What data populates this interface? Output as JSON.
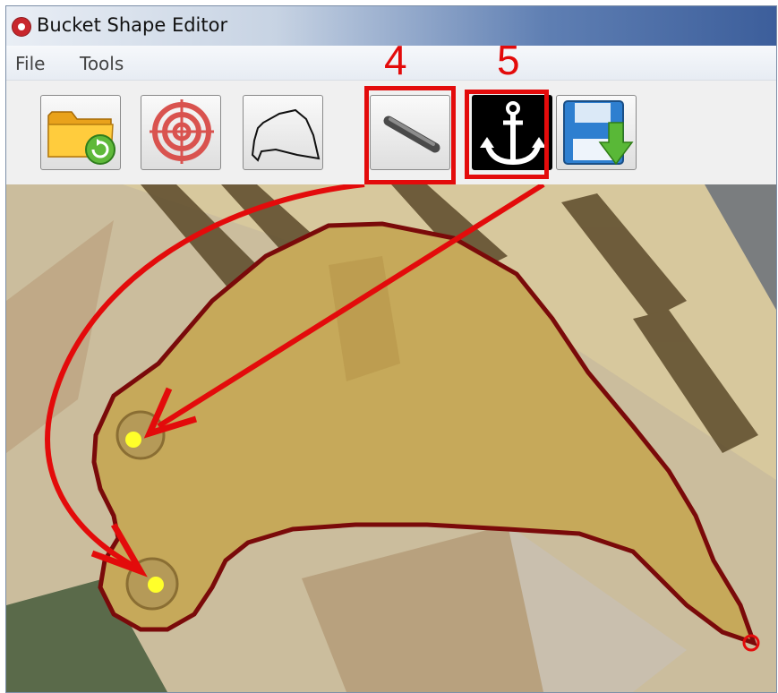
{
  "window": {
    "title": "Bucket Shape Editor"
  },
  "menu": {
    "items": [
      "File",
      "Tools"
    ]
  },
  "toolbar": {
    "buttons": [
      {
        "name": "open-folder",
        "icon": "folder-refresh-icon"
      },
      {
        "name": "target",
        "icon": "target-icon"
      },
      {
        "name": "bucket-outline",
        "icon": "bucket-outline-icon"
      },
      {
        "name": "pin",
        "icon": "pin-icon"
      },
      {
        "name": "anchor",
        "icon": "anchor-icon"
      },
      {
        "name": "save",
        "icon": "save-icon"
      }
    ]
  },
  "annotations": {
    "callout_4": "4",
    "callout_5": "5"
  },
  "colors": {
    "callout_red": "#e30b0b",
    "outline": "#7a0a0a",
    "pin_marker": "#ffff2a",
    "bucket": "#c9ad5f"
  }
}
